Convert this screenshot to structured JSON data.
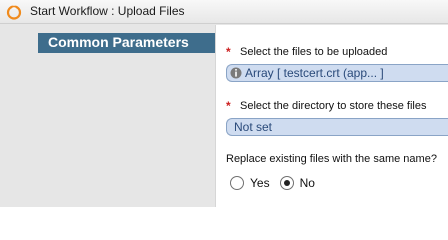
{
  "window": {
    "title": "Start Workflow : Upload Files",
    "app_icon": "workflow-icon"
  },
  "sidebar": {
    "section_title": "Common Parameters"
  },
  "form": {
    "files_field": {
      "required_marker": "*",
      "label": "Select the files to be uploaded",
      "value": "Array [ testcert.crt (app... ]",
      "icon": "info-icon"
    },
    "directory_field": {
      "required_marker": "*",
      "label": "Select the directory to store these files",
      "value": "Not set"
    },
    "replace_question": {
      "label": "Replace existing files with the same name?",
      "options": [
        {
          "label": "Yes",
          "selected": false
        },
        {
          "label": "No",
          "selected": true
        }
      ]
    }
  },
  "colors": {
    "section_header_bg": "#3e6d8c",
    "field_bg": "#cfdcf0",
    "required": "#cc1f1f"
  }
}
